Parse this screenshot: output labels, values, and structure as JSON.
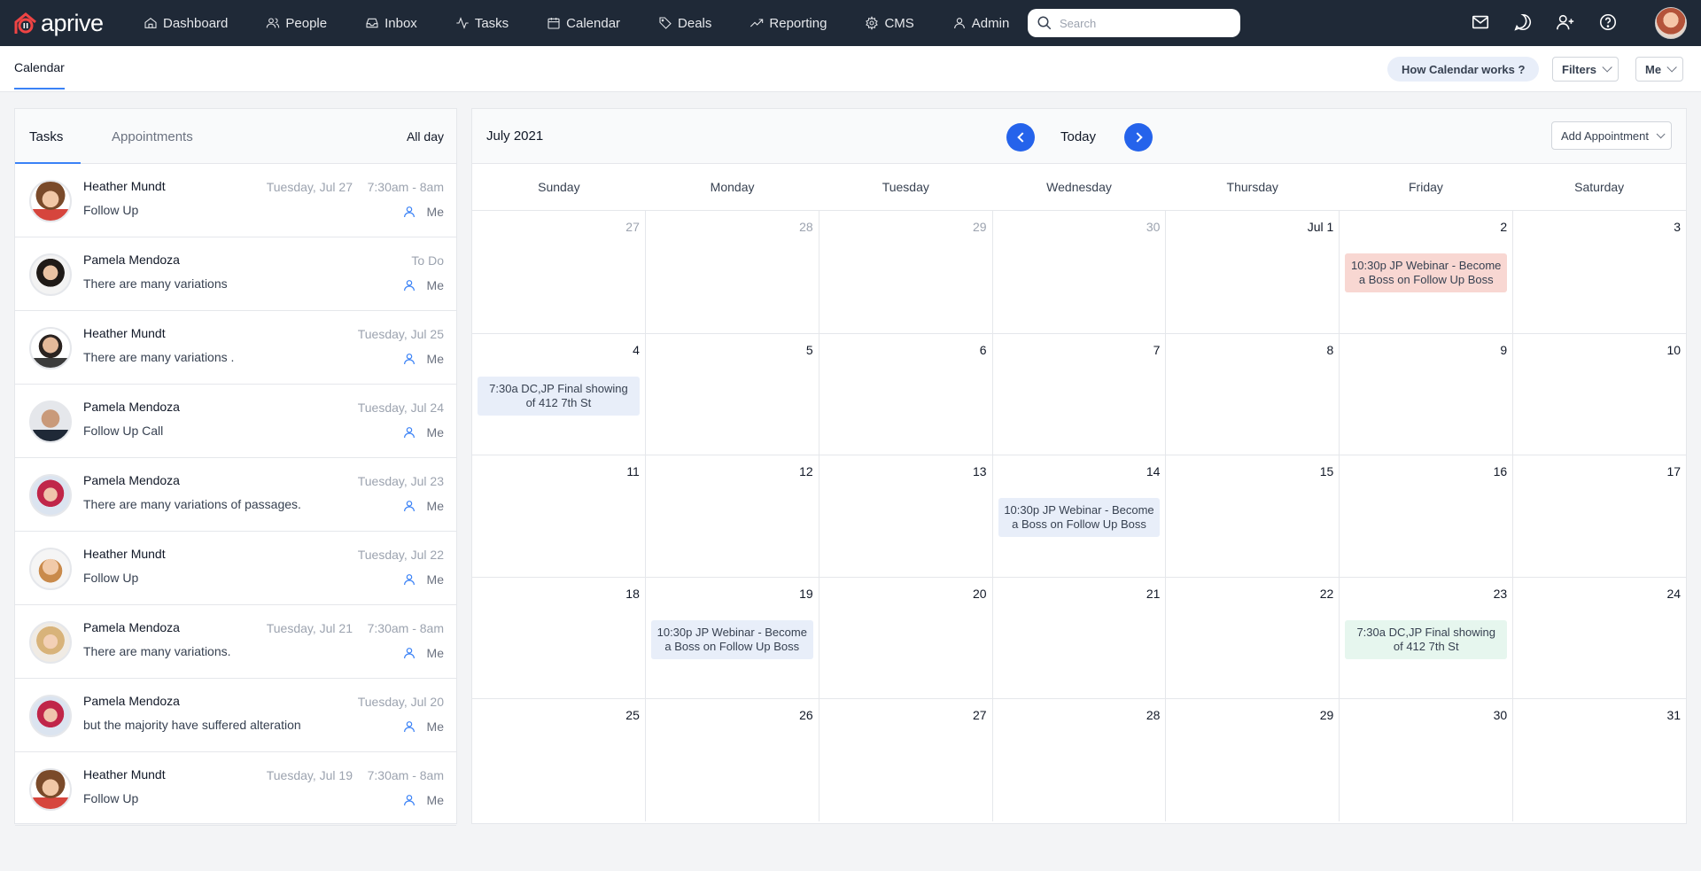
{
  "app": {
    "brand": "aprive"
  },
  "nav": [
    {
      "label": "Dashboard",
      "icon": "home-icon"
    },
    {
      "label": "People",
      "icon": "people-icon"
    },
    {
      "label": "Inbox",
      "icon": "inbox-icon"
    },
    {
      "label": "Tasks",
      "icon": "activity-icon"
    },
    {
      "label": "Calendar",
      "icon": "calendar-icon"
    },
    {
      "label": "Deals",
      "icon": "tag-icon"
    },
    {
      "label": "Reporting",
      "icon": "trend-icon"
    },
    {
      "label": "CMS",
      "icon": "gear-icon"
    },
    {
      "label": "Admin",
      "icon": "user-icon"
    }
  ],
  "search": {
    "placeholder": "Search",
    "value": ""
  },
  "subheader": {
    "title": "Calendar",
    "help_button": "How Calendar works ?",
    "filters_button": "Filters",
    "me_button": "Me"
  },
  "left_panel": {
    "tabs": [
      "Tasks",
      "Appointments"
    ],
    "active_tab": "Tasks",
    "all_day": "All day",
    "tasks": [
      {
        "name": "Heather Mundt",
        "desc": "Follow Up",
        "date": "Tuesday, Jul 27",
        "time": "7:30am - 8am",
        "assignee": "Me",
        "avatar": "avatar-curly"
      },
      {
        "name": "Pamela Mendoza",
        "desc": "There are many variations",
        "date": "To Do",
        "time": "",
        "assignee": "Me",
        "avatar": "avatar-woman-dark"
      },
      {
        "name": "Heather Mundt",
        "desc": "There are many variations .",
        "date": "Tuesday, Jul 25",
        "time": "",
        "assignee": "Me",
        "avatar": "avatar-man-beard"
      },
      {
        "name": "Pamela Mendoza",
        "desc": "Follow Up Call",
        "date": "Tuesday, Jul 24",
        "time": "",
        "assignee": "Me",
        "avatar": "avatar-man-bald"
      },
      {
        "name": "Pamela Mendoza",
        "desc": "There are many variations of passages.",
        "date": "Tuesday, Jul 23",
        "time": "",
        "assignee": "Me",
        "avatar": "avatar-woman-red"
      },
      {
        "name": "Heather Mundt",
        "desc": "Follow Up",
        "date": "Tuesday, Jul 22",
        "time": "",
        "assignee": "Me",
        "avatar": "avatar-man-glasses"
      },
      {
        "name": "Pamela Mendoza",
        "desc": "There are many variations.",
        "date": "Tuesday, Jul 21",
        "time": "7:30am - 8am",
        "assignee": "Me",
        "avatar": "avatar-woman-blonde"
      },
      {
        "name": "Pamela Mendoza",
        "desc": "but the majority have suffered alteration",
        "date": "Tuesday, Jul 20",
        "time": "",
        "assignee": "Me",
        "avatar": "avatar-woman-red"
      },
      {
        "name": "Heather Mundt",
        "desc": "Follow Up",
        "date": "Tuesday, Jul 19",
        "time": "7:30am - 8am",
        "assignee": "Me",
        "avatar": "avatar-curly"
      }
    ]
  },
  "calendar": {
    "month": "July 2021",
    "today_label": "Today",
    "add_button": "Add Appointment",
    "weekdays": [
      "Sunday",
      "Monday",
      "Tuesday",
      "Wednesday",
      "Thursday",
      "Friday",
      "Saturday"
    ],
    "weeks": [
      [
        {
          "num": "27",
          "muted": true
        },
        {
          "num": "28",
          "muted": true
        },
        {
          "num": "29",
          "muted": true
        },
        {
          "num": "30",
          "muted": true
        },
        {
          "num": "Jul 1"
        },
        {
          "num": "2",
          "event": {
            "text": "10:30p JP Webinar - Become a Boss on Follow Up Boss",
            "color": "#f8d7d2"
          }
        },
        {
          "num": "3"
        }
      ],
      [
        {
          "num": "4",
          "event": {
            "text": "7:30a DC,JP Final showing of 412 7th St",
            "color": "#e8eef9"
          }
        },
        {
          "num": "5"
        },
        {
          "num": "6"
        },
        {
          "num": "7"
        },
        {
          "num": "8"
        },
        {
          "num": "9"
        },
        {
          "num": "10"
        }
      ],
      [
        {
          "num": "11"
        },
        {
          "num": "12"
        },
        {
          "num": "13"
        },
        {
          "num": "14",
          "event": {
            "text": "10:30p JP Webinar - Become a Boss on Follow Up Boss",
            "color": "#e8eef9"
          }
        },
        {
          "num": "15"
        },
        {
          "num": "16"
        },
        {
          "num": "17"
        }
      ],
      [
        {
          "num": "18"
        },
        {
          "num": "19",
          "event": {
            "text": "10:30p JP Webinar - Become a Boss on Follow Up Boss",
            "color": "#e8eef9"
          }
        },
        {
          "num": "20"
        },
        {
          "num": "21"
        },
        {
          "num": "22"
        },
        {
          "num": "23",
          "event": {
            "text": "7:30a DC,JP Final showing of 412 7th St",
            "color": "#e6f6ee"
          }
        },
        {
          "num": "24"
        }
      ],
      [
        {
          "num": "25"
        },
        {
          "num": "26"
        },
        {
          "num": "27"
        },
        {
          "num": "28"
        },
        {
          "num": "29"
        },
        {
          "num": "30"
        },
        {
          "num": "31"
        }
      ]
    ]
  }
}
